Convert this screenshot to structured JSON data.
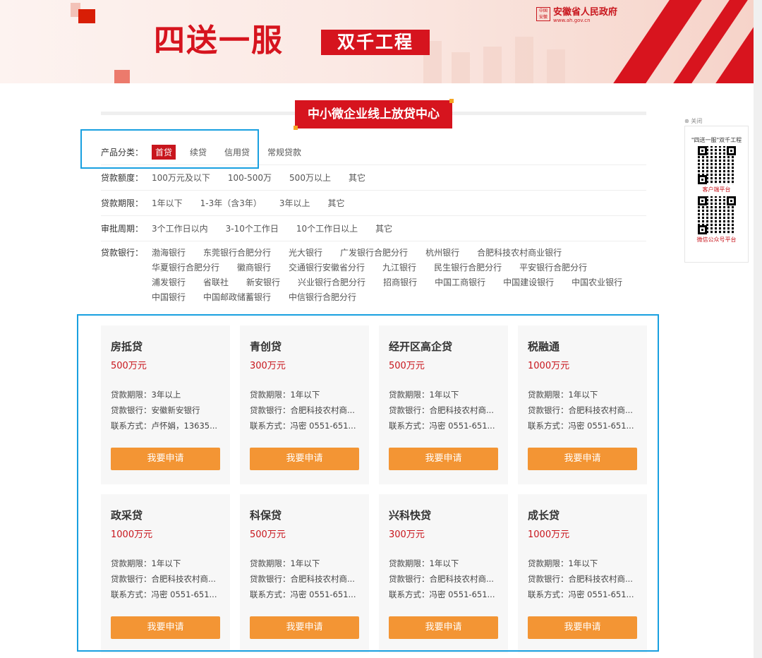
{
  "banner": {
    "title": "四送一服",
    "tag": "双千工程",
    "gov_logo": [
      "中",
      "国",
      "安",
      "徽"
    ],
    "gov_name": "安徽省人民政府",
    "gov_url": "www.ah.gov.cn"
  },
  "section": {
    "title": "中小微企业线上放贷中心"
  },
  "filters": {
    "category": {
      "label": "产品分类：",
      "options": [
        "首贷",
        "续贷",
        "信用贷",
        "常规贷款"
      ]
    },
    "amount": {
      "label": "贷款额度：",
      "options": [
        "100万元及以下",
        "100-500万",
        "500万以上",
        "其它"
      ]
    },
    "term": {
      "label": "贷款期限：",
      "options": [
        "1年以下",
        "1-3年（含3年）",
        "3年以上",
        "其它"
      ]
    },
    "approval": {
      "label": "审批周期：",
      "options": [
        "3个工作日以内",
        "3-10个工作日",
        "10个工作日以上",
        "其它"
      ]
    },
    "bank": {
      "label": "贷款银行：",
      "options": [
        "渤海银行",
        "东莞银行合肥分行",
        "光大银行",
        "广发银行合肥分行",
        "杭州银行",
        "合肥科技农村商业银行",
        "华夏银行合肥分行",
        "徽商银行",
        "交通银行安徽省分行",
        "九江银行",
        "民生银行合肥分行",
        "平安银行合肥分行",
        "浦发银行",
        "省联社",
        "新安银行",
        "兴业银行合肥分行",
        "招商银行",
        "中国工商银行",
        "中国建设银行",
        "中国农业银行",
        "中国银行",
        "中国邮政储蓄银行",
        "中信银行合肥分行"
      ]
    }
  },
  "cards": [
    {
      "name": "房抵贷",
      "amount": "500万元",
      "term": "贷款期限：3年以上",
      "bank": "贷款银行：安徽新安银行",
      "contact": "联系方式：卢怀娟，13635...",
      "button": "我要申请"
    },
    {
      "name": "青创贷",
      "amount": "300万元",
      "term": "贷款期限：1年以下",
      "bank": "贷款银行：合肥科技农村商...",
      "contact": "联系方式：冯密 0551-651...",
      "button": "我要申请"
    },
    {
      "name": "经开区高企贷",
      "amount": "500万元",
      "term": "贷款期限：1年以下",
      "bank": "贷款银行：合肥科技农村商...",
      "contact": "联系方式：冯密 0551-651...",
      "button": "我要申请"
    },
    {
      "name": "税融通",
      "amount": "1000万元",
      "term": "贷款期限：1年以下",
      "bank": "贷款银行：合肥科技农村商...",
      "contact": "联系方式：冯密 0551-651...",
      "button": "我要申请"
    },
    {
      "name": "政采贷",
      "amount": "1000万元",
      "term": "贷款期限：1年以下",
      "bank": "贷款银行：合肥科技农村商...",
      "contact": "联系方式：冯密 0551-651...",
      "button": "我要申请"
    },
    {
      "name": "科保贷",
      "amount": "500万元",
      "term": "贷款期限：1年以下",
      "bank": "贷款银行：合肥科技农村商...",
      "contact": "联系方式：冯密 0551-651...",
      "button": "我要申请"
    },
    {
      "name": "兴科快贷",
      "amount": "300万元",
      "term": "贷款期限：1年以下",
      "bank": "贷款银行：合肥科技农村商...",
      "contact": "联系方式：冯密 0551-651...",
      "button": "我要申请"
    },
    {
      "name": "成长贷",
      "amount": "1000万元",
      "term": "贷款期限：1年以下",
      "bank": "贷款银行：合肥科技农村商...",
      "contact": "联系方式：冯密 0551-651...",
      "button": "我要申请"
    }
  ],
  "side": {
    "close": "⊗ 关闭",
    "title": "\"四送一服\"双千工程",
    "qr1_caption": "客户端平台",
    "qr2_caption": "微信公众号平台"
  },
  "colors": {
    "brand_red": "#d6141e",
    "button_orange": "#f39534",
    "highlight_blue": "#19a0e0"
  }
}
